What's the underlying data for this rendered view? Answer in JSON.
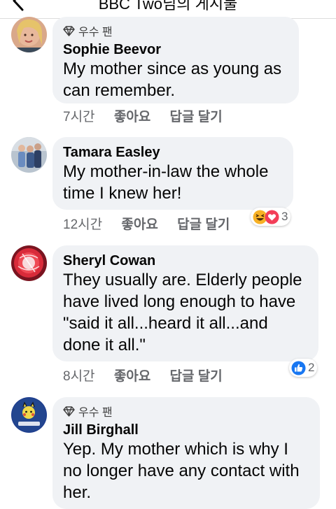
{
  "header": {
    "title": "BBC Two님의 게시물"
  },
  "comments": [
    {
      "badge": "우수 팬",
      "author": "Sophie Beevor",
      "text": "My mother since as young as can remember.",
      "time": "7시간",
      "like": "좋아요",
      "reply": "답글 달기"
    },
    {
      "author": "Tamara Easley",
      "text": "My mother-in-law the whole time I knew her!",
      "time": "12시간",
      "like": "좋아요",
      "reply": "답글 달기",
      "reaction_count": "3"
    },
    {
      "author": "Sheryl Cowan",
      "text": "They usually are. Elderly people have lived long enough to have \"said it all...heard it all...and done it all.\"",
      "time": "8시간",
      "like": "좋아요",
      "reply": "답글 달기",
      "reaction_count": "2"
    },
    {
      "badge": "우수 팬",
      "author": "Jill Birghall",
      "text": "Yep. My mother which is why I no longer have any contact with her."
    }
  ],
  "colors": {
    "bubble": "#f0f2f5",
    "like_blue": "#1877f2",
    "love_red": "#f33e58",
    "haha_yellow": "#f7b125"
  }
}
